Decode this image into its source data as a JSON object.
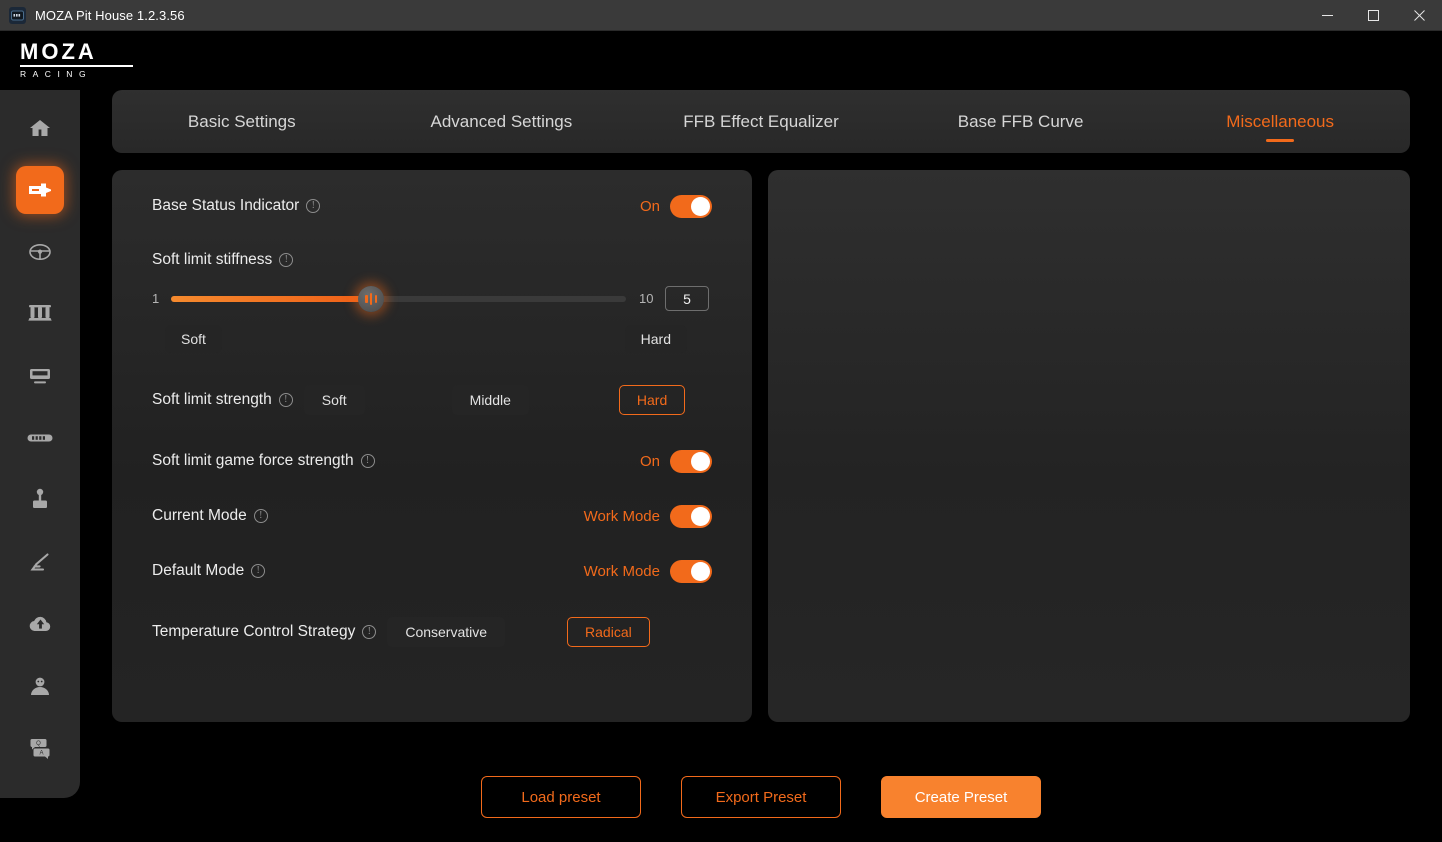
{
  "window": {
    "title": "MOZA Pit House 1.2.3.56",
    "app_icon": "moza-app-icon",
    "minimize_label": "—",
    "maximize_label": "☐",
    "close_label": "✕"
  },
  "brand": {
    "name": "MOZA",
    "tagline": "RACING"
  },
  "sidebar": {
    "items": [
      {
        "name": "home",
        "icon": "home-icon",
        "active": false
      },
      {
        "name": "wheelbase",
        "icon": "wheelbase-icon",
        "active": true
      },
      {
        "name": "steering-wheel",
        "icon": "steering-wheel-icon",
        "active": false
      },
      {
        "name": "pedals",
        "icon": "pedals-icon",
        "active": false
      },
      {
        "name": "dash-display",
        "icon": "dash-display-icon",
        "active": false
      },
      {
        "name": "button-box",
        "icon": "button-box-icon",
        "active": false
      },
      {
        "name": "shifter",
        "icon": "shifter-icon",
        "active": false
      },
      {
        "name": "handbrake",
        "icon": "handbrake-icon",
        "active": false
      },
      {
        "name": "cloud",
        "icon": "cloud-upload-icon",
        "active": false
      },
      {
        "name": "profile",
        "icon": "user-icon",
        "active": false
      },
      {
        "name": "support",
        "icon": "qa-chat-icon",
        "active": false
      }
    ]
  },
  "tabs": [
    {
      "label": "Basic Settings",
      "active": false
    },
    {
      "label": "Advanced Settings",
      "active": false
    },
    {
      "label": "FFB Effect Equalizer",
      "active": false
    },
    {
      "label": "Base FFB Curve",
      "active": false
    },
    {
      "label": "Miscellaneous",
      "active": true
    }
  ],
  "settings": {
    "base_status_indicator": {
      "label": "Base Status Indicator",
      "value": "On"
    },
    "soft_limit_stiffness": {
      "label": "Soft limit stiffness",
      "min": "1",
      "max": "10",
      "value": "5",
      "percent": 44,
      "left_marker": "Soft",
      "right_marker": "Hard"
    },
    "soft_limit_strength": {
      "label": "Soft limit strength",
      "options": [
        "Soft",
        "Middle",
        "Hard"
      ],
      "selected": "Hard"
    },
    "soft_limit_game_force_strength": {
      "label": "Soft limit game force strength",
      "value": "On"
    },
    "current_mode": {
      "label": "Current Mode",
      "value": "Work Mode"
    },
    "default_mode": {
      "label": "Default Mode",
      "value": "Work Mode"
    },
    "temperature_control_strategy": {
      "label": "Temperature Control Strategy",
      "options": [
        "Conservative",
        "Radical"
      ],
      "selected": "Radical"
    },
    "info_glyph": "!"
  },
  "footer": {
    "load_preset": "Load preset",
    "export_preset": "Export Preset",
    "create_preset": "Create Preset"
  },
  "colors": {
    "accent": "#f26a1b",
    "accent_light": "#f8822e",
    "panel_bg": "#232323",
    "sidebar_bg": "#2b2b2b",
    "titlebar_bg": "#3a3a3a",
    "text": "#ececec"
  }
}
